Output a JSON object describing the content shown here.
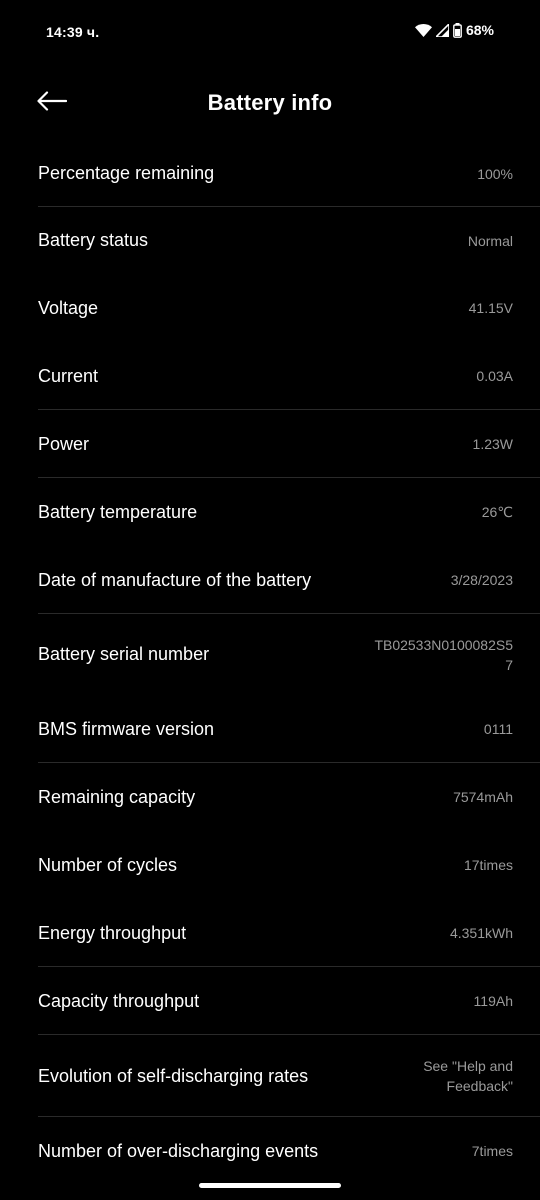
{
  "status_bar": {
    "time": "14:39 ч.",
    "battery": "68%"
  },
  "header": {
    "title": "Battery info"
  },
  "rows": [
    {
      "label": "Percentage remaining",
      "value": "100%"
    },
    {
      "label": "Battery status",
      "value": "Normal"
    },
    {
      "label": "Voltage",
      "value": "41.15V"
    },
    {
      "label": "Current",
      "value": "0.03A"
    },
    {
      "label": "Power",
      "value": "1.23W"
    },
    {
      "label": "Battery temperature",
      "value": "26℃"
    },
    {
      "label": "Date of manufacture of the battery",
      "value": "3/28/2023"
    },
    {
      "label": "Battery serial number",
      "value": "TB02533N0100082S57"
    },
    {
      "label": "BMS firmware version",
      "value": "0111"
    },
    {
      "label": "Remaining capacity",
      "value": "7574mAh"
    },
    {
      "label": "Number of cycles",
      "value": "17times"
    },
    {
      "label": "Energy throughput",
      "value": "4.351kWh"
    },
    {
      "label": "Capacity throughput",
      "value": "119Ah"
    },
    {
      "label": "Evolution of self-discharging rates",
      "value": "See \"Help and Feedback\""
    },
    {
      "label": "Number of over-discharging events",
      "value": "7times"
    }
  ]
}
